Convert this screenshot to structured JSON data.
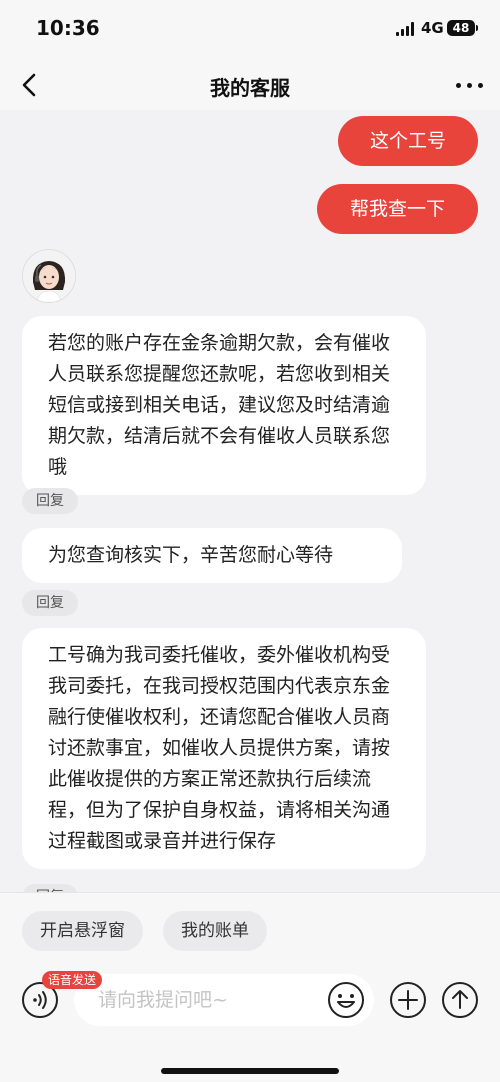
{
  "status": {
    "time": "10:36",
    "network": "4G",
    "battery": "48"
  },
  "header": {
    "title": "我的客服"
  },
  "messages": {
    "outgoing": [
      "这个工号",
      "帮我查一下"
    ],
    "incoming": [
      "若您的账户存在金条逾期欠款，会有催收人员联系您提醒您还款呢，若您收到相关短信或接到相关电话，建议您及时结清逾期欠款，结清后就不会有催收人员联系您哦",
      "为您查询核实下，辛苦您耐心等待",
      "工号确为我司委托催收，委外催收机构受我司委托，在我司授权范围内代表京东金融行使催收权利，还请您配合催收人员商讨还款事宜，如催收人员提供方案，请按此催收提供的方案正常还款执行后续流程，但为了保护自身权益，请将相关沟通过程截图或录音并进行保存"
    ],
    "reply_label": "回复"
  },
  "quick_actions": [
    "开启悬浮窗",
    "我的账单"
  ],
  "input": {
    "placeholder": "请向我提问吧~",
    "voice_badge": "语音发送"
  },
  "colors": {
    "accent": "#e8443c"
  }
}
